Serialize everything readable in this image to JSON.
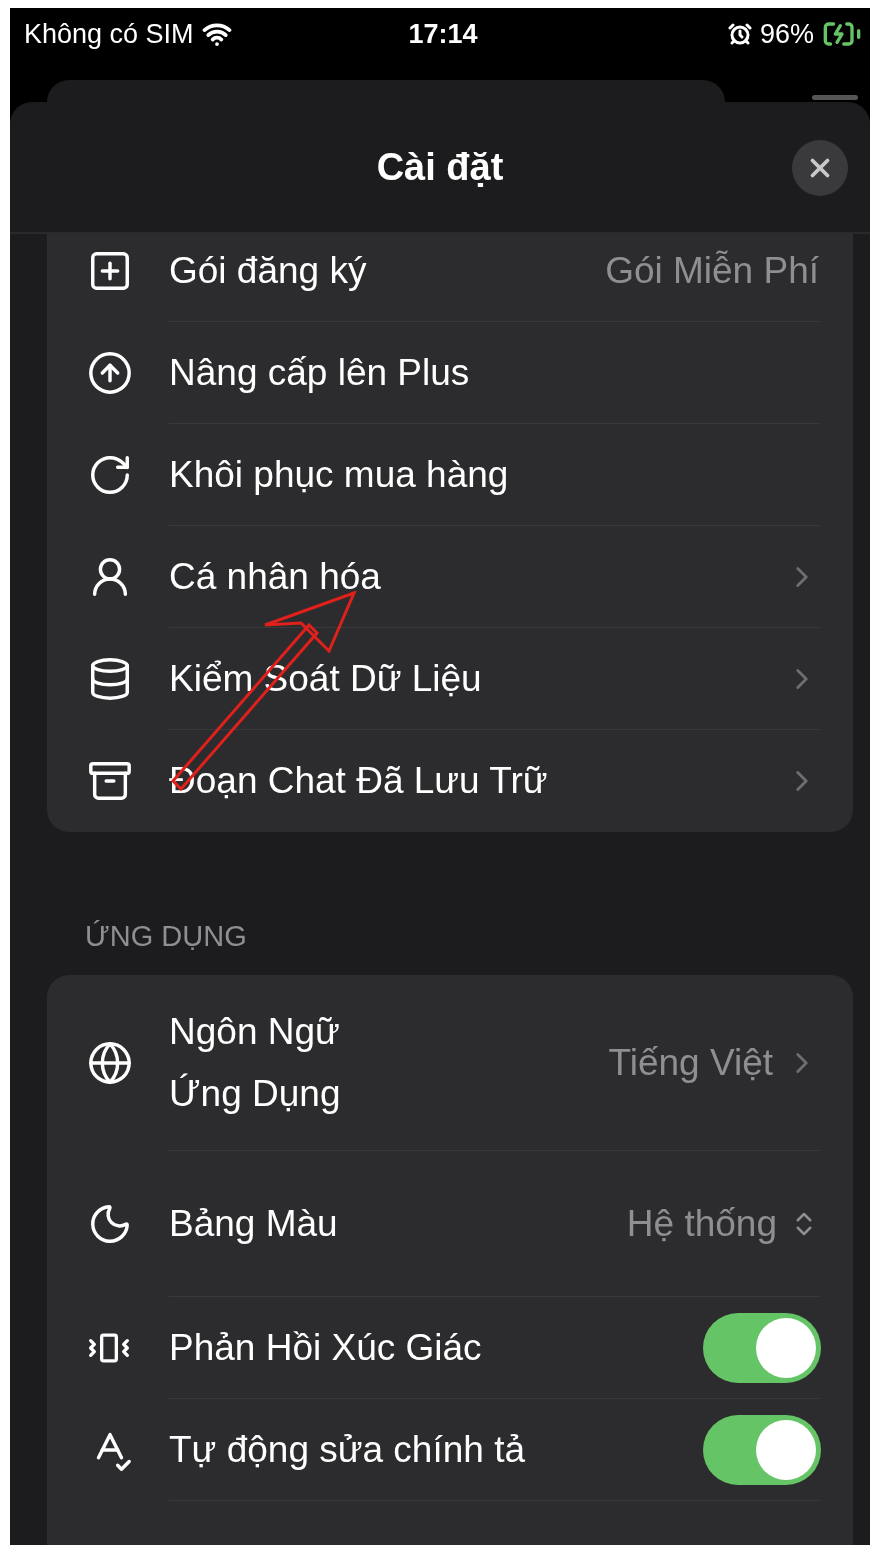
{
  "status_bar": {
    "carrier": "Không có SIM",
    "time": "17:14",
    "battery": "96%"
  },
  "sheet": {
    "title": "Cài đặt"
  },
  "groups": [
    {
      "rows": [
        {
          "kind": "value",
          "label": "Gói đăng ký",
          "value": "Gói Miễn Phí"
        },
        {
          "kind": "plain",
          "label": "Nâng cấp lên Plus"
        },
        {
          "kind": "plain",
          "label": "Khôi phục mua hàng"
        },
        {
          "kind": "link",
          "label": "Cá nhân hóa"
        },
        {
          "kind": "link",
          "label": "Kiểm Soát Dữ Liệu"
        },
        {
          "kind": "link",
          "label": "Đoạn Chat Đã Lưu Trữ"
        }
      ]
    },
    {
      "header": "ỨNG DỤNG",
      "rows": [
        {
          "kind": "link",
          "label": "Ngôn Ngữ Ứng Dụng",
          "value": "Tiếng Việt"
        },
        {
          "kind": "menu",
          "label": "Bảng Màu",
          "value": "Hệ thống"
        },
        {
          "kind": "toggle",
          "label": "Phản Hồi Xúc Giác",
          "on": true
        },
        {
          "kind": "toggle",
          "label": "Tự động sửa chính tả",
          "on": true
        }
      ]
    }
  ]
}
